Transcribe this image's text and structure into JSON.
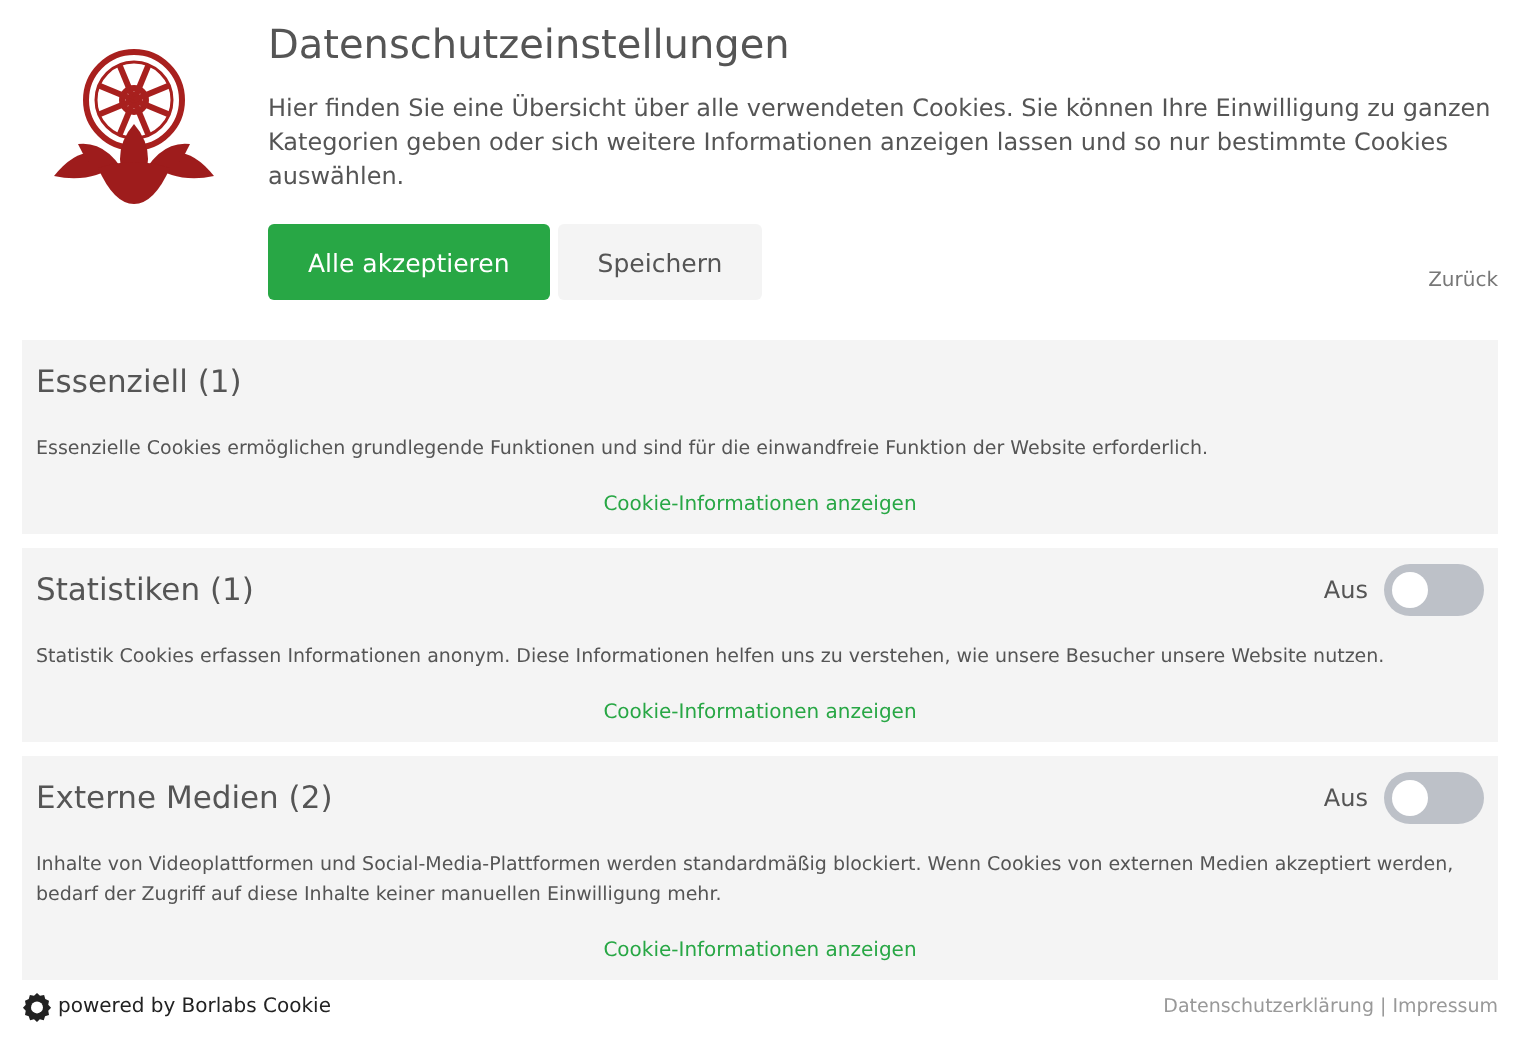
{
  "header": {
    "title": "Datenschutzeinstellungen",
    "description": "Hier finden Sie eine Übersicht über alle verwendeten Cookies. Sie können Ihre Einwilligung zu ganzen Kategorien geben oder sich weitere Informationen anzeigen lassen und so nur bestimmte Cookies auswählen.",
    "buttons": [
      {
        "label": "Alle akzeptieren",
        "kind": "primary"
      },
      {
        "label": "Speichern",
        "kind": "secondary"
      }
    ],
    "back_link": "Zurück"
  },
  "categories": [
    {
      "title": "Essenziell (1)",
      "description": "Essenzielle Cookies ermöglichen grundlegende Funktionen und sind für die einwandfreie Funktion der Website erforderlich.",
      "link": "Cookie-Informationen anzeigen"
    },
    {
      "title": "Statistiken (1)",
      "toggle": {
        "label": "Aus",
        "on": false
      },
      "description": "Statistik Cookies erfassen Informationen anonym. Diese Informationen helfen uns zu verstehen, wie unsere Besucher unsere Website nutzen.",
      "link": "Cookie-Informationen anzeigen"
    },
    {
      "title": "Externe Medien (2)",
      "toggle": {
        "label": "Aus",
        "on": false
      },
      "description": "Inhalte von Videoplattformen und Social-Media-Plattformen werden standardmäßig blockiert. Wenn Cookies von externen Medien akzeptiert werden, bedarf der Zugriff auf diese Inhalte keiner manuellen Einwilligung mehr.",
      "link": "Cookie-Informationen anzeigen"
    }
  ],
  "footer": {
    "powered_by": "powered by Borlabs Cookie",
    "links": [
      "Datenschutzerklärung",
      "Impressum"
    ],
    "separator": "|"
  }
}
